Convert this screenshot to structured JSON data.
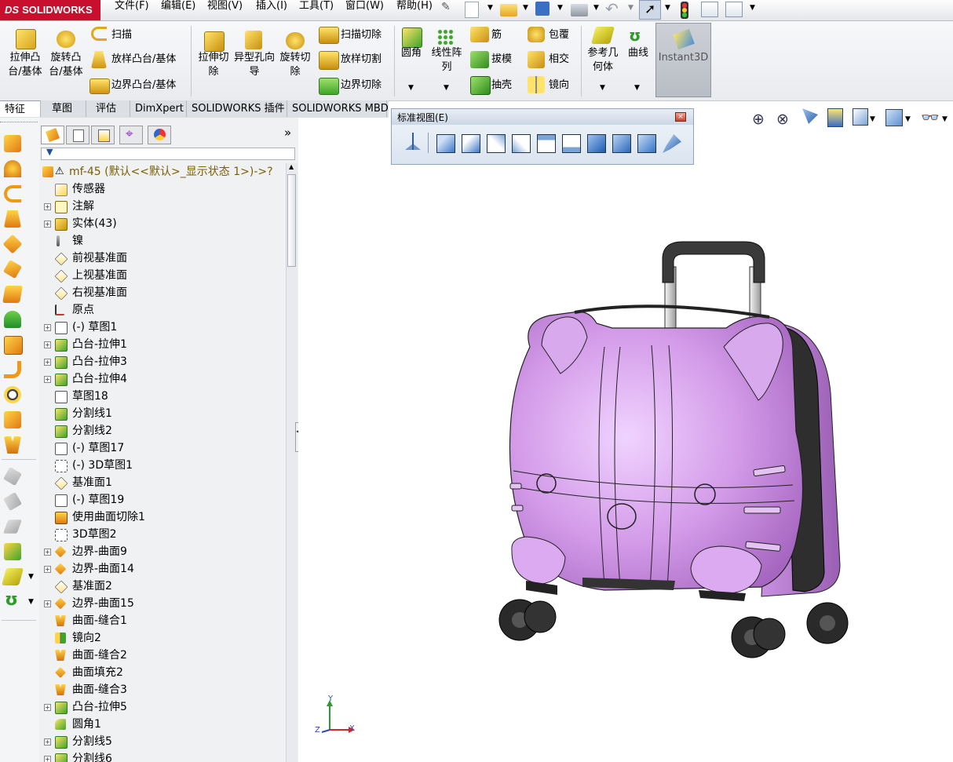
{
  "app": {
    "brand_prefix": "DS",
    "brand": "SOLIDWORKS"
  },
  "menu": [
    "文件(F)",
    "编辑(E)",
    "视图(V)",
    "插入(I)",
    "工具(T)",
    "窗口(W)",
    "帮助(H)"
  ],
  "ribbon": {
    "extrude_boss": "拉伸凸台/基体",
    "revolve_boss": "旋转凸台/基体",
    "sweep": "扫描",
    "loft_boss": "放样凸台/基体",
    "boundary_boss": "边界凸台/基体",
    "extrude_cut": "拉伸切除",
    "hole_wizard": "异型孔向导",
    "revolve_cut": "旋转切除",
    "swept_cut": "扫描切除",
    "lofted_cut": "放样切割",
    "boundary_cut": "边界切除",
    "fillet": "圆角",
    "linear_pattern": "线性阵列",
    "rib": "筋",
    "draft": "拔模",
    "shell": "抽壳",
    "wrap": "包覆",
    "intersect": "相交",
    "mirror": "镜向",
    "ref_geometry": "参考几何体",
    "curves": "曲线",
    "instant3d": "Instant3D"
  },
  "tabs": [
    "特征",
    "草图",
    "评估",
    "DimXpert",
    "SOLIDWORKS 插件",
    "SOLIDWORKS MBD"
  ],
  "std_views": {
    "title": "标准视图(E)"
  },
  "tree": {
    "root": "mf-45  (默认<<默认>_显示状态 1>)->?",
    "items": [
      {
        "label": "传感器",
        "icon": "sensor-icon",
        "expand": false
      },
      {
        "label": "注解",
        "icon": "annotation-icon",
        "expand": true
      },
      {
        "label": "实体(43)",
        "icon": "solid-bodies-icon",
        "expand": true
      },
      {
        "label": "镍",
        "icon": "material-icon",
        "expand": false
      },
      {
        "label": "前视基准面",
        "icon": "plane-icon",
        "expand": false
      },
      {
        "label": "上视基准面",
        "icon": "plane-icon",
        "expand": false
      },
      {
        "label": "右视基准面",
        "icon": "plane-icon",
        "expand": false
      },
      {
        "label": "原点",
        "icon": "origin-icon",
        "expand": false
      },
      {
        "label": "(-) 草图1",
        "icon": "sketch-icon",
        "expand": true
      },
      {
        "label": "凸台-拉伸1",
        "icon": "extrude-icon",
        "expand": true
      },
      {
        "label": "凸台-拉伸3",
        "icon": "extrude-icon",
        "expand": true
      },
      {
        "label": "凸台-拉伸4",
        "icon": "extrude-icon",
        "expand": true
      },
      {
        "label": "草图18",
        "icon": "sketch-icon",
        "expand": false
      },
      {
        "label": "分割线1",
        "icon": "split-line-icon",
        "expand": false
      },
      {
        "label": "分割线2",
        "icon": "split-line-icon",
        "expand": false
      },
      {
        "label": "(-) 草图17",
        "icon": "sketch-icon",
        "expand": false
      },
      {
        "label": "(-) 3D草图1",
        "icon": "sketch3d-icon",
        "expand": false
      },
      {
        "label": "基准面1",
        "icon": "plane-icon",
        "expand": false
      },
      {
        "label": "(-) 草图19",
        "icon": "sketch-icon",
        "expand": false
      },
      {
        "label": "使用曲面切除1",
        "icon": "surface-cut-icon",
        "expand": false
      },
      {
        "label": "3D草图2",
        "icon": "sketch3d-icon",
        "expand": false
      },
      {
        "label": "边界-曲面9",
        "icon": "boundary-surface-icon",
        "expand": true
      },
      {
        "label": "边界-曲面14",
        "icon": "boundary-surface-icon",
        "expand": true
      },
      {
        "label": "基准面2",
        "icon": "plane-icon",
        "expand": false
      },
      {
        "label": "边界-曲面15",
        "icon": "boundary-surface-icon",
        "expand": true
      },
      {
        "label": "曲面-缝合1",
        "icon": "knit-icon",
        "expand": false
      },
      {
        "label": "镜向2",
        "icon": "mirror-icon",
        "expand": false
      },
      {
        "label": "曲面-缝合2",
        "icon": "knit-icon",
        "expand": false
      },
      {
        "label": "曲面填充2",
        "icon": "fill-surface-icon",
        "expand": false
      },
      {
        "label": "曲面-缝合3",
        "icon": "knit-icon",
        "expand": false
      },
      {
        "label": "凸台-拉伸5",
        "icon": "extrude-icon",
        "expand": true
      },
      {
        "label": "圆角1",
        "icon": "fillet-icon",
        "expand": false
      },
      {
        "label": "分割线5",
        "icon": "split-line-icon",
        "expand": true
      },
      {
        "label": "分割线6",
        "icon": "split-line-icon",
        "expand": true
      }
    ]
  },
  "triad": {
    "x": "X",
    "y": "Y",
    "z": "Z"
  },
  "colors": {
    "brand": "#c8102e",
    "model": "#d8a4ee",
    "model_dark": "#9a62b3",
    "wheels": "#2a2a2a",
    "handle": "#3a3a3a"
  }
}
